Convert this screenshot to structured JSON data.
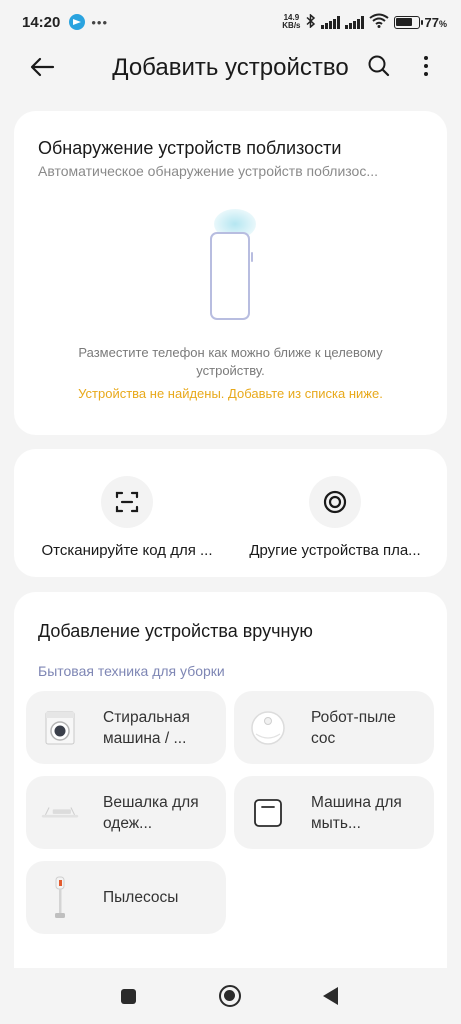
{
  "status_bar": {
    "time": "14:20",
    "dots": "•••",
    "net_speed_value": "14.9",
    "net_speed_unit": "KB/s",
    "battery_level": 0.77,
    "battery_text": "77"
  },
  "header": {
    "title": "Добавить устройство"
  },
  "discover": {
    "title": "Обнаружение устройств поблизости",
    "subtitle": "Автоматическое обнаружение устройств поблизос...",
    "hint": "Разместите телефон как можно ближе к целевому устройству.",
    "warning": "Устройства не найдены. Добавьте из списка ниже."
  },
  "actions": [
    {
      "label": "Отсканируйте код для ..."
    },
    {
      "label": "Другие устройства пла..."
    }
  ],
  "manual": {
    "title": "Добавление устройства вручную",
    "category": "Бытовая техника для уборки",
    "tiles": [
      {
        "label": "Стиральная машина / ...",
        "icon": "washing-machine-icon"
      },
      {
        "label": "Робот-пыле сос",
        "icon": "robot-vacuum-icon"
      },
      {
        "label": "Вешалка для одеж...",
        "icon": "clothes-hanger-icon"
      },
      {
        "label": "Машина для мыть...",
        "icon": "floor-washer-icon"
      },
      {
        "label": "Пылесосы",
        "icon": "vacuum-cleaner-icon"
      }
    ]
  },
  "colors": {
    "accent_warning": "#e8a91b",
    "category": "#7e86b4",
    "background": "#f4f4f4"
  }
}
